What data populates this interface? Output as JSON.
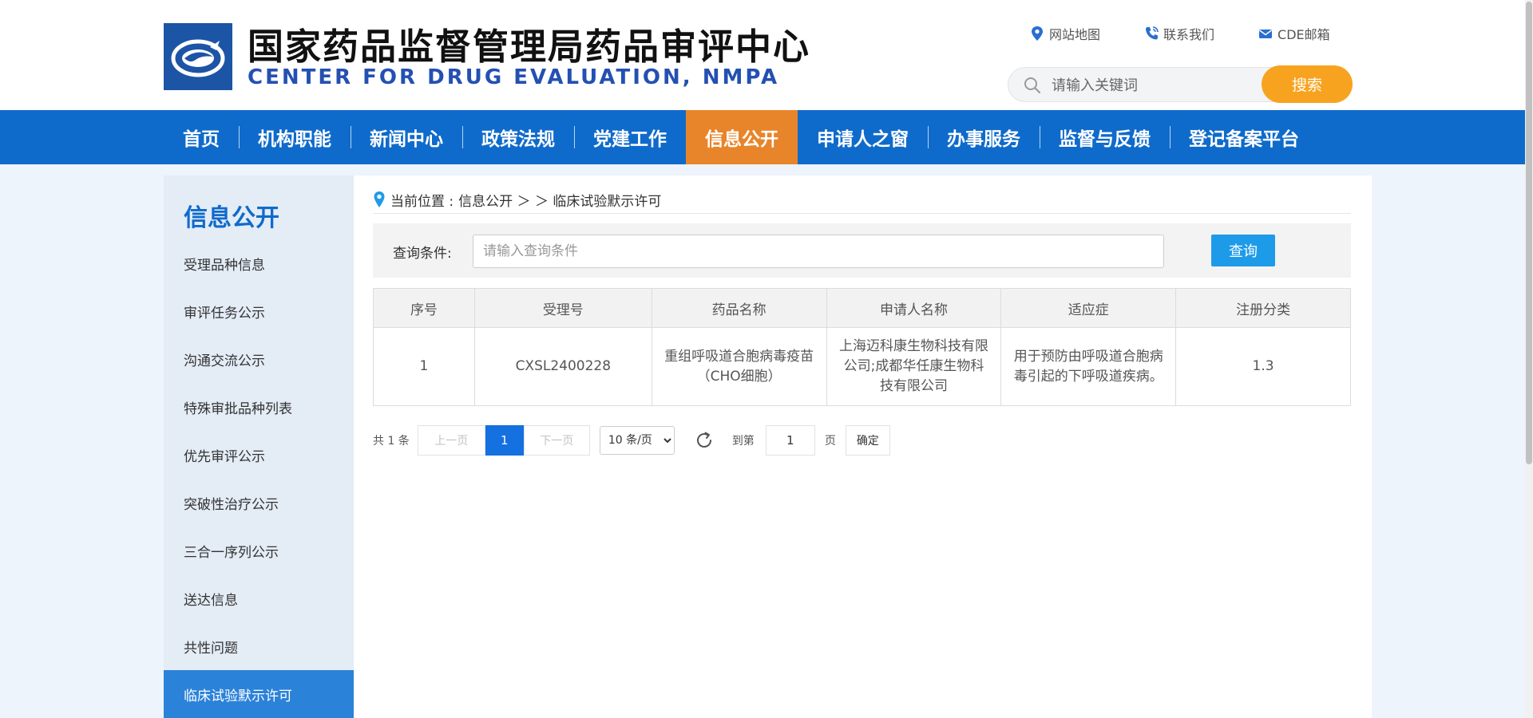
{
  "header": {
    "title_cn": "国家药品监督管理局药品审评中心",
    "title_en": "CENTER FOR DRUG EVALUATION, NMPA",
    "top_links": [
      {
        "label": "网站地图",
        "icon": "location-pin-icon"
      },
      {
        "label": "联系我们",
        "icon": "phone-icon"
      },
      {
        "label": "CDE邮箱",
        "icon": "mail-icon"
      }
    ],
    "search": {
      "placeholder": "请输入关键词",
      "button_label": "搜索"
    }
  },
  "nav": {
    "items": [
      "首页",
      "机构职能",
      "新闻中心",
      "政策法规",
      "党建工作",
      "信息公开",
      "申请人之窗",
      "办事服务",
      "监督与反馈",
      "登记备案平台"
    ],
    "active": "信息公开"
  },
  "sidebar": {
    "title": "信息公开",
    "items": [
      "受理品种信息",
      "审评任务公示",
      "沟通交流公示",
      "特殊审批品种列表",
      "优先审评公示",
      "突破性治疗公示",
      "三合一序列公示",
      "送达信息",
      "共性问题",
      "临床试验默示许可"
    ],
    "active": "临床试验默示许可"
  },
  "breadcrumb": {
    "prefix": "当前位置 :",
    "path": "信息公开 ＞ ＞ 临床试验默示许可"
  },
  "query": {
    "label": "查询条件:",
    "placeholder": "请输入查询条件",
    "button_label": "查询"
  },
  "table": {
    "columns": [
      "序号",
      "受理号",
      "药品名称",
      "申请人名称",
      "适应症",
      "注册分类"
    ],
    "rows": [
      [
        "1",
        "CXSL2400228",
        "重组呼吸道合胞病毒疫苗（CHO细胞）",
        "上海迈科康生物科技有限公司;成都华任康生物科技有限公司",
        "用于预防由呼吸道合胞病毒引起的下呼吸道疾病。",
        "1.3"
      ]
    ]
  },
  "pagination": {
    "total": "共 1 条",
    "prev": "上一页",
    "current": "1",
    "next": "下一页",
    "page_size": "10 条/页",
    "goto": "到第",
    "goto_value": "1",
    "unit": "页",
    "confirm": "确定"
  },
  "colors": {
    "nav_bg": "#0f6bcb",
    "nav_active": "#e8852a",
    "search_button": "#f8a31f",
    "title_en": "#2450b2",
    "sidebar_active": "#2b82d9",
    "query_button": "#1e9be8"
  }
}
